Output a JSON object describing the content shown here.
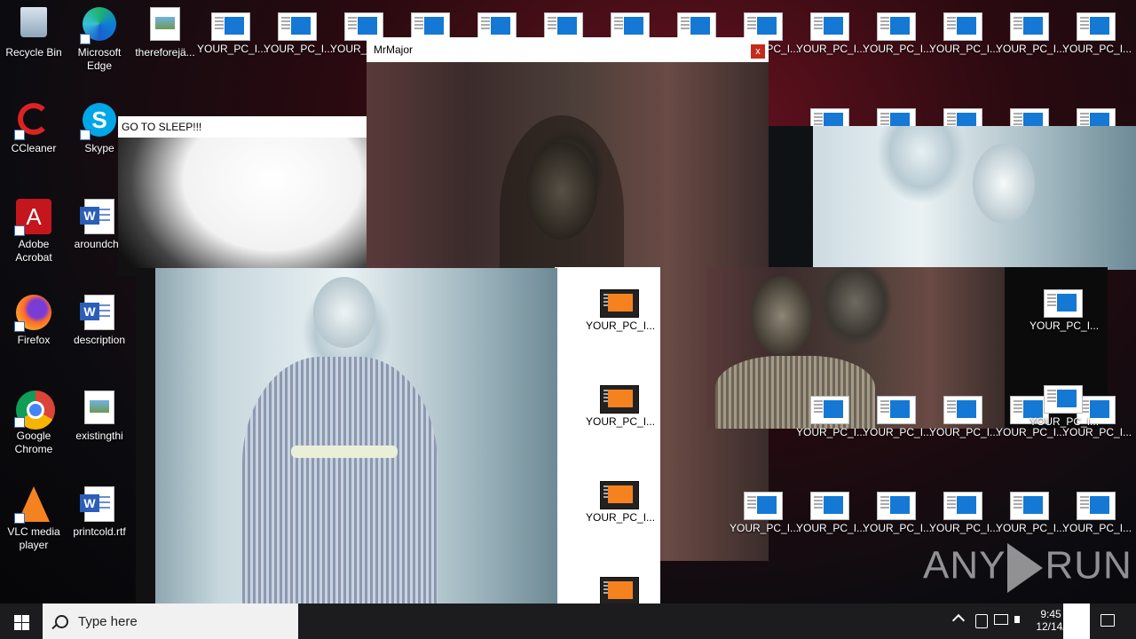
{
  "desktop_icons": [
    {
      "label": "Recycle Bin"
    },
    {
      "label": "Microsoft Edge"
    },
    {
      "label": "thereforejä..."
    },
    {
      "label": "CCleaner"
    },
    {
      "label": "Skype"
    },
    {
      "label": "Adobe Acrobat"
    },
    {
      "label": "aroundcha"
    },
    {
      "label": "Firefox"
    },
    {
      "label": "description"
    },
    {
      "label": "Google Chrome"
    },
    {
      "label": "existingthi"
    },
    {
      "label": "VLC media player"
    },
    {
      "label": "printcold.rtf"
    }
  ],
  "tile_label": "YOUR_PC_I...",
  "tile_label_alt": "YOUR_PC_I...",
  "windows": {
    "mrmajor": {
      "title": "MrMajor",
      "close": "x"
    },
    "sleep": {
      "title": "GO TO SLEEP!!!"
    }
  },
  "taskbar": {
    "search_placeholder": "Type here",
    "search_suffix": "...",
    "time": "9:45",
    "date": "12/14/"
  },
  "watermark": {
    "left": "ANY",
    "right": "RUN"
  },
  "error_icon": "✕",
  "colors": {
    "accent": "#1578d4",
    "error": "#c10e0e",
    "tile_orange": "#f5821f"
  }
}
